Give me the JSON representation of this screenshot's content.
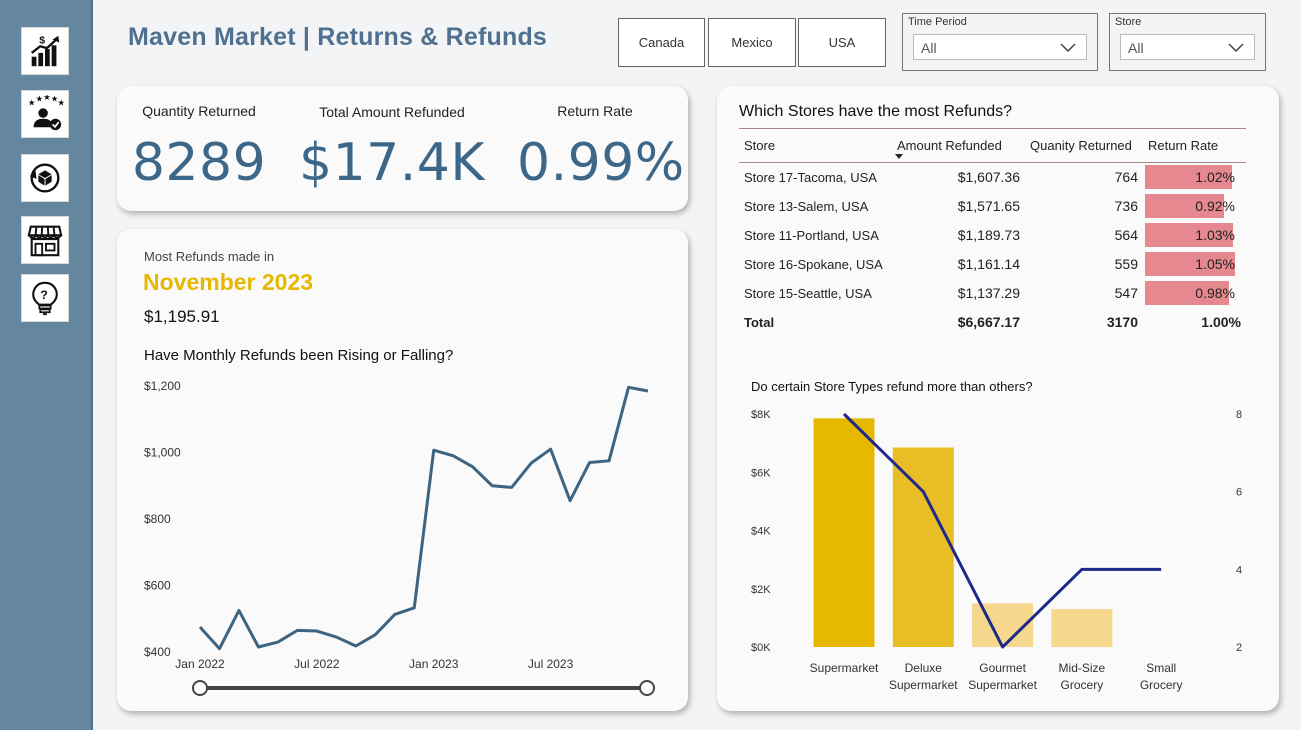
{
  "header": {
    "title": "Maven Market | Returns & Refunds",
    "countries": [
      "Canada",
      "Mexico",
      "USA"
    ],
    "time_period": {
      "label": "Time Period",
      "value": "All"
    },
    "store": {
      "label": "Store",
      "value": "All"
    }
  },
  "sidebar": {
    "items": [
      {
        "icon": "sales-chart-icon"
      },
      {
        "icon": "customer-rating-icon"
      },
      {
        "icon": "returns-icon"
      },
      {
        "icon": "store-icon"
      },
      {
        "icon": "help-icon"
      }
    ]
  },
  "kpis": [
    {
      "label": "Quantity Returned",
      "value": "8289"
    },
    {
      "label": "Total Amount Refunded",
      "value": "$17.4K"
    },
    {
      "label": "Return Rate",
      "value": "0.99%"
    }
  ],
  "most_refunds": {
    "label": "Most Refunds made in",
    "month": "November 2023",
    "amount": "$1,195.91",
    "question": "Have Monthly Refunds been Rising or Falling?"
  },
  "stores_table": {
    "title": "Which Stores have the most Refunds?",
    "columns": [
      "Store",
      "Amount Refunded",
      "Quanity Returned",
      "Return Rate"
    ],
    "rows": [
      {
        "store": "Store 17-Tacoma, USA",
        "amount": "$1,607.36",
        "qty": "764",
        "rate": "1.02%",
        "rate_value": 1.02
      },
      {
        "store": "Store 13-Salem, USA",
        "amount": "$1,571.65",
        "qty": "736",
        "rate": "0.92%",
        "rate_value": 0.92
      },
      {
        "store": "Store 11-Portland, USA",
        "amount": "$1,189.73",
        "qty": "564",
        "rate": "1.03%",
        "rate_value": 1.03
      },
      {
        "store": "Store 16-Spokane, USA",
        "amount": "$1,161.14",
        "qty": "559",
        "rate": "1.05%",
        "rate_value": 1.05
      },
      {
        "store": "Store 15-Seattle, USA",
        "amount": "$1,137.29",
        "qty": "547",
        "rate": "0.98%",
        "rate_value": 0.98
      }
    ],
    "total": {
      "store": "Total",
      "amount": "$6,667.17",
      "qty": "3170",
      "rate": "1.00%"
    }
  },
  "colors": {
    "title": "#4f7090",
    "kpi": "#3d6788",
    "accent_yellow": "#e6b800",
    "line": "#3d6480",
    "bar_fill": "#e5888f",
    "combo_line": "#1d2a8a"
  },
  "chart_data": [
    {
      "type": "line",
      "title": "Have Monthly Refunds been Rising or Falling?",
      "x": [
        "2022-01",
        "2022-02",
        "2022-03",
        "2022-04",
        "2022-05",
        "2022-06",
        "2022-07",
        "2022-08",
        "2022-09",
        "2022-10",
        "2022-11",
        "2022-12",
        "2023-01",
        "2023-02",
        "2023-03",
        "2023-04",
        "2023-05",
        "2023-06",
        "2023-07",
        "2023-08",
        "2023-09",
        "2023-10",
        "2023-11",
        "2023-12"
      ],
      "x_ticks": [
        "Jan 2022",
        "Jul 2022",
        "Jan 2023",
        "Jul 2023"
      ],
      "series": [
        {
          "values": [
            475,
            410,
            525,
            415,
            430,
            465,
            463,
            445,
            418,
            452,
            513,
            533,
            1007,
            990,
            957,
            900,
            895,
            968,
            1010,
            855,
            970,
            975,
            1196,
            1185
          ]
        }
      ],
      "y_ticks": [
        "$400",
        "$600",
        "$800",
        "$1,000",
        "$1,200"
      ],
      "ylim": [
        400,
        1200
      ],
      "grid": false
    },
    {
      "type": "bar",
      "title": "Do certain Store Types refund more than others?",
      "categories": [
        "Supermarket",
        "Deluxe Supermarket",
        "Gourmet Supermarket",
        "Mid-Size Grocery",
        "Small Grocery"
      ],
      "series": [
        {
          "values": [
            7850,
            6850,
            1500,
            1300,
            0
          ]
        },
        {
          "values": [
            8,
            6,
            2,
            4,
            4
          ]
        }
      ],
      "y_ticks": [
        "$0K",
        "$2K",
        "$4K",
        "$6K",
        "$8K"
      ],
      "ylim": [
        0,
        8000
      ],
      "y2_ticks": [
        "2",
        "4",
        "6",
        "8"
      ],
      "y2lim": [
        2,
        8
      ],
      "bar_colors": [
        "#e6b800",
        "#e8bd26",
        "#f6d78e",
        "#f6d78e",
        "#f6d78e"
      ]
    }
  ]
}
